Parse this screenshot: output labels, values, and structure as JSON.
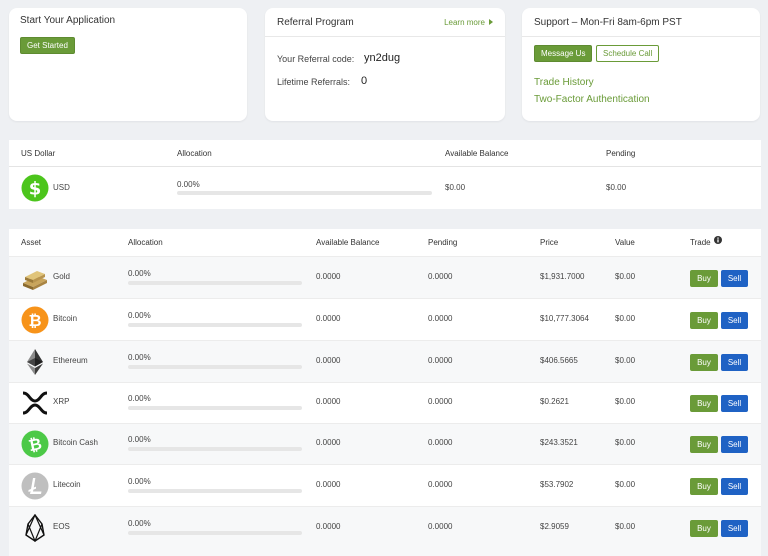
{
  "start_app": {
    "title": "Start Your Application",
    "button": "Get Started"
  },
  "referral": {
    "title": "Referral Program",
    "learn_more": "Learn more",
    "code_label": "Your Referral code:",
    "code_value": "yn2dug",
    "lifetime_label": "Lifetime Referrals:",
    "lifetime_value": "0"
  },
  "support": {
    "title": "Support – Mon-Fri 8am-6pm PST",
    "message_button": "Message Us",
    "schedule_button": "Schedule Call",
    "links": [
      "Trade History",
      "Two-Factor Authentication"
    ]
  },
  "usd": {
    "headers": [
      "US Dollar",
      "Allocation",
      "Available Balance",
      "Pending"
    ],
    "name": "USD",
    "allocation": "0.00%",
    "allocation_fraction": 0,
    "available": "$0.00",
    "pending": "$0.00"
  },
  "assets_table": {
    "headers": [
      "Asset",
      "Allocation",
      "Available Balance",
      "Pending",
      "Price",
      "Value",
      "Trade"
    ],
    "buy_label": "Buy",
    "sell_label": "Sell",
    "rows": [
      {
        "icon": "gold-bar-icon",
        "name": "Gold",
        "allocation": "0.00%",
        "available": "0.0000",
        "pending": "0.0000",
        "price": "$1,931.7000",
        "value": "$0.00"
      },
      {
        "icon": "bitcoin-icon",
        "name": "Bitcoin",
        "allocation": "0.00%",
        "available": "0.0000",
        "pending": "0.0000",
        "price": "$10,777.3064",
        "value": "$0.00"
      },
      {
        "icon": "ethereum-icon",
        "name": "Ethereum",
        "allocation": "0.00%",
        "available": "0.0000",
        "pending": "0.0000",
        "price": "$406.5665",
        "value": "$0.00"
      },
      {
        "icon": "xrp-icon",
        "name": "XRP",
        "allocation": "0.00%",
        "available": "0.0000",
        "pending": "0.0000",
        "price": "$0.2621",
        "value": "$0.00"
      },
      {
        "icon": "bitcoin-cash-icon",
        "name": "Bitcoin Cash",
        "allocation": "0.00%",
        "available": "0.0000",
        "pending": "0.0000",
        "price": "$243.3521",
        "value": "$0.00"
      },
      {
        "icon": "litecoin-icon",
        "name": "Litecoin",
        "allocation": "0.00%",
        "available": "0.0000",
        "pending": "0.0000",
        "price": "$53.7902",
        "value": "$0.00"
      },
      {
        "icon": "eos-icon",
        "name": "EOS",
        "allocation": "0.00%",
        "available": "0.0000",
        "pending": "0.0000",
        "price": "$2.9059",
        "value": "$0.00"
      }
    ]
  },
  "colors": {
    "accent_green": "#6a9b38",
    "sell_blue": "#1f62c4",
    "usd_green": "#4cc51c",
    "bitcoin_orange": "#f7931a",
    "bitcoin_cash_green": "#4cc947",
    "litecoin_gray": "#bfbfbf"
  }
}
